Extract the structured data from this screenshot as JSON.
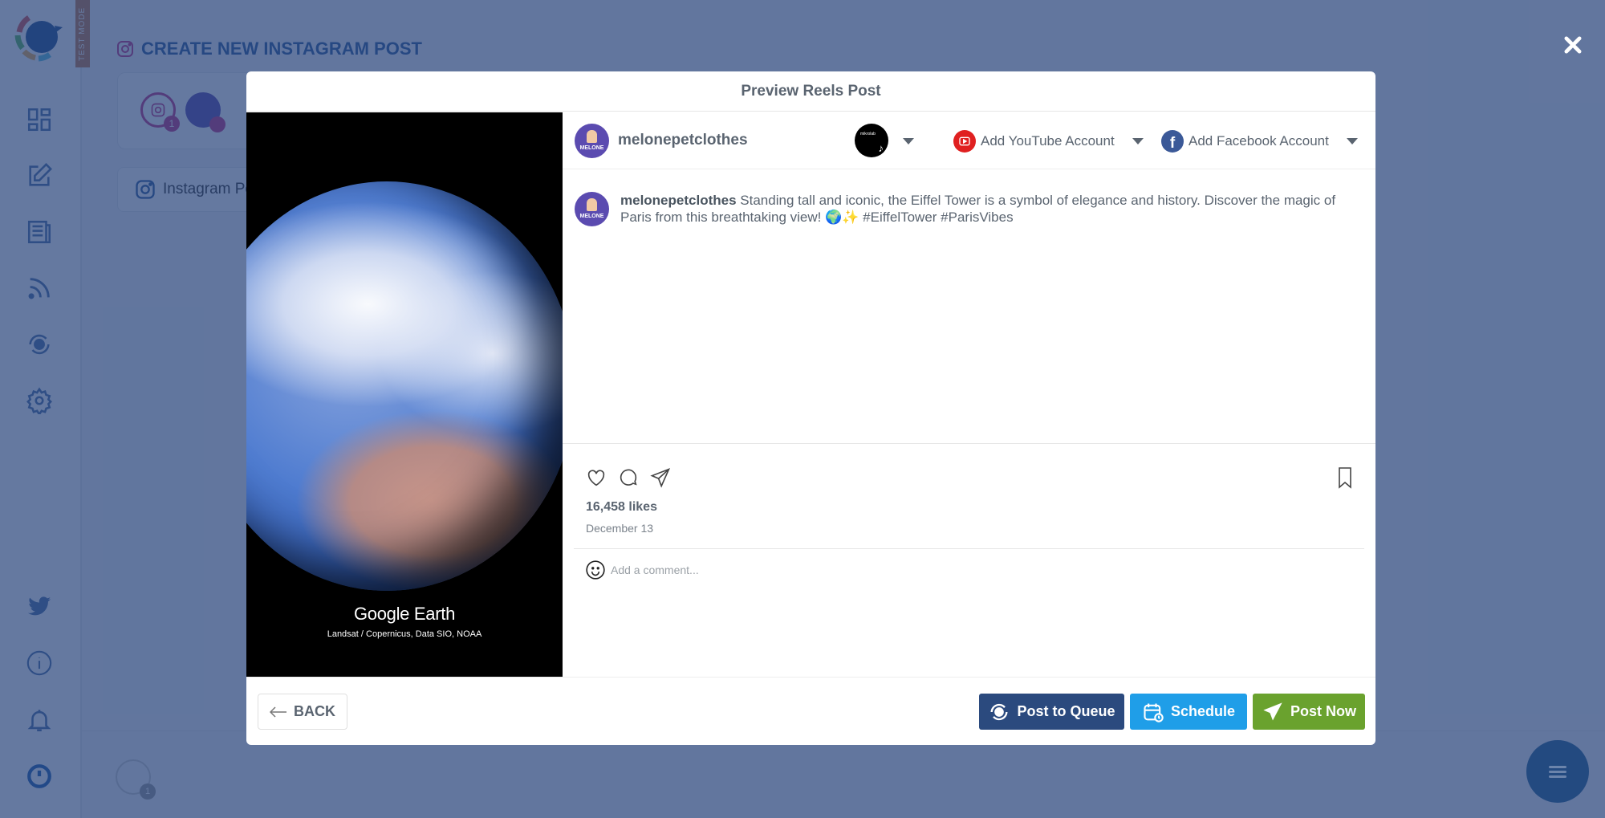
{
  "app": {
    "test_mode_label": "TEST MODE",
    "page_title": "CREATE NEW INSTAGRAM POST",
    "selected_account_badge": "1",
    "tab_label": "Instagram Post",
    "bottom_badge": "1",
    "sidebar": {
      "items": [
        {
          "icon": "dashboard-icon"
        },
        {
          "icon": "compose-icon"
        },
        {
          "icon": "posts-icon"
        },
        {
          "icon": "rss-icon"
        },
        {
          "icon": "queue-icon"
        },
        {
          "icon": "settings-icon"
        }
      ],
      "bottom_items": [
        {
          "icon": "twitter-icon"
        },
        {
          "icon": "info-icon"
        },
        {
          "icon": "bell-icon"
        },
        {
          "icon": "power-icon"
        }
      ]
    }
  },
  "modal": {
    "title": "Preview Reels Post",
    "media": {
      "brand": "Google Earth",
      "credit": "Landsat / Copernicus, Data SIO, NOAA"
    },
    "account": {
      "username": "melonepetclothes",
      "avatar_text": "MELONE",
      "tiktok_label": "mikrolab"
    },
    "add_youtube": "Add YouTube Account",
    "add_facebook": "Add Facebook Account",
    "caption": {
      "username": "melonepetclothes",
      "text": "Standing tall and iconic, the Eiffel Tower is a symbol of elegance and history. Discover the magic of Paris from this breathtaking view! 🌍✨ #EiffelTower #ParisVibes"
    },
    "likes": "16,458 likes",
    "date": "December 13",
    "comment_placeholder": "Add a comment...",
    "footer": {
      "back": "BACK",
      "post_to_queue": "Post to Queue",
      "schedule": "Schedule",
      "post_now": "Post Now"
    }
  },
  "colors": {
    "queue": "#2b4a7e",
    "schedule": "#1f9ee8",
    "post_now": "#6aa22e",
    "youtube": "#e02020",
    "facebook": "#3b5998",
    "instagram": "#c13584"
  }
}
